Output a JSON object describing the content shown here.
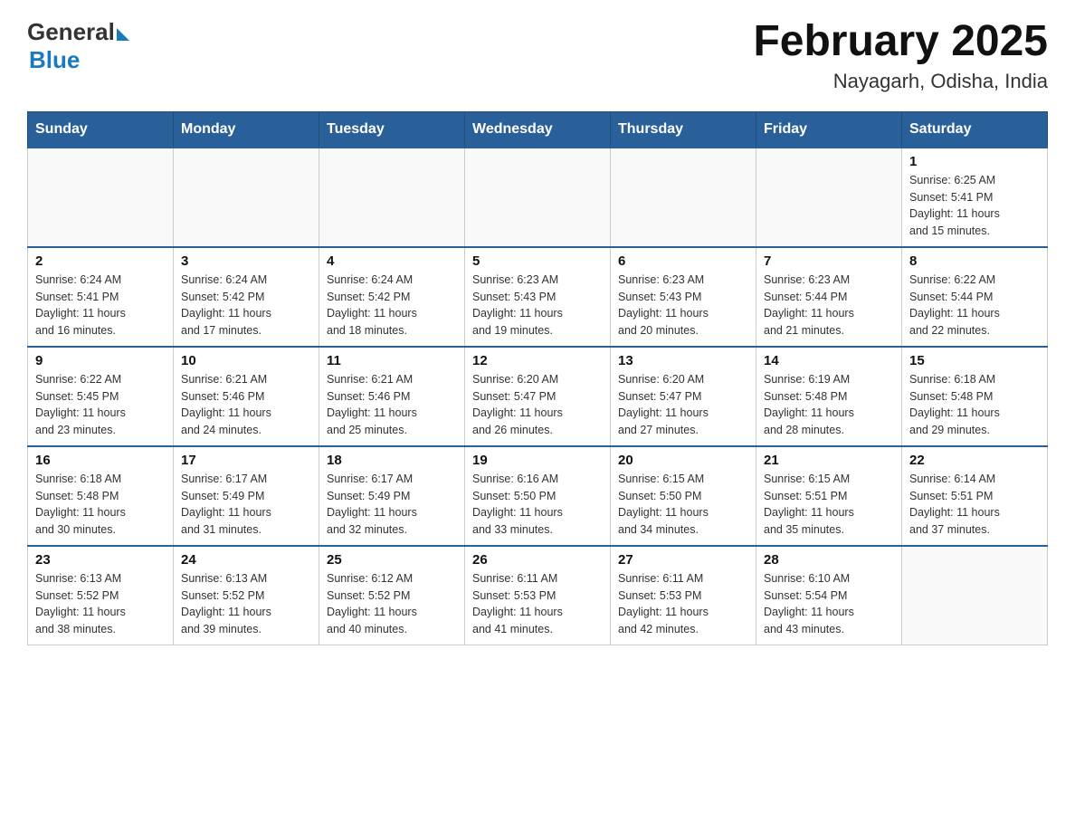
{
  "header": {
    "logo": {
      "general": "General",
      "blue": "Blue",
      "arrow": "▶"
    },
    "title": "February 2025",
    "location": "Nayagarh, Odisha, India"
  },
  "days_of_week": [
    "Sunday",
    "Monday",
    "Tuesday",
    "Wednesday",
    "Thursday",
    "Friday",
    "Saturday"
  ],
  "weeks": [
    [
      {
        "day": "",
        "info": ""
      },
      {
        "day": "",
        "info": ""
      },
      {
        "day": "",
        "info": ""
      },
      {
        "day": "",
        "info": ""
      },
      {
        "day": "",
        "info": ""
      },
      {
        "day": "",
        "info": ""
      },
      {
        "day": "1",
        "info": "Sunrise: 6:25 AM\nSunset: 5:41 PM\nDaylight: 11 hours\nand 15 minutes."
      }
    ],
    [
      {
        "day": "2",
        "info": "Sunrise: 6:24 AM\nSunset: 5:41 PM\nDaylight: 11 hours\nand 16 minutes."
      },
      {
        "day": "3",
        "info": "Sunrise: 6:24 AM\nSunset: 5:42 PM\nDaylight: 11 hours\nand 17 minutes."
      },
      {
        "day": "4",
        "info": "Sunrise: 6:24 AM\nSunset: 5:42 PM\nDaylight: 11 hours\nand 18 minutes."
      },
      {
        "day": "5",
        "info": "Sunrise: 6:23 AM\nSunset: 5:43 PM\nDaylight: 11 hours\nand 19 minutes."
      },
      {
        "day": "6",
        "info": "Sunrise: 6:23 AM\nSunset: 5:43 PM\nDaylight: 11 hours\nand 20 minutes."
      },
      {
        "day": "7",
        "info": "Sunrise: 6:23 AM\nSunset: 5:44 PM\nDaylight: 11 hours\nand 21 minutes."
      },
      {
        "day": "8",
        "info": "Sunrise: 6:22 AM\nSunset: 5:44 PM\nDaylight: 11 hours\nand 22 minutes."
      }
    ],
    [
      {
        "day": "9",
        "info": "Sunrise: 6:22 AM\nSunset: 5:45 PM\nDaylight: 11 hours\nand 23 minutes."
      },
      {
        "day": "10",
        "info": "Sunrise: 6:21 AM\nSunset: 5:46 PM\nDaylight: 11 hours\nand 24 minutes."
      },
      {
        "day": "11",
        "info": "Sunrise: 6:21 AM\nSunset: 5:46 PM\nDaylight: 11 hours\nand 25 minutes."
      },
      {
        "day": "12",
        "info": "Sunrise: 6:20 AM\nSunset: 5:47 PM\nDaylight: 11 hours\nand 26 minutes."
      },
      {
        "day": "13",
        "info": "Sunrise: 6:20 AM\nSunset: 5:47 PM\nDaylight: 11 hours\nand 27 minutes."
      },
      {
        "day": "14",
        "info": "Sunrise: 6:19 AM\nSunset: 5:48 PM\nDaylight: 11 hours\nand 28 minutes."
      },
      {
        "day": "15",
        "info": "Sunrise: 6:18 AM\nSunset: 5:48 PM\nDaylight: 11 hours\nand 29 minutes."
      }
    ],
    [
      {
        "day": "16",
        "info": "Sunrise: 6:18 AM\nSunset: 5:48 PM\nDaylight: 11 hours\nand 30 minutes."
      },
      {
        "day": "17",
        "info": "Sunrise: 6:17 AM\nSunset: 5:49 PM\nDaylight: 11 hours\nand 31 minutes."
      },
      {
        "day": "18",
        "info": "Sunrise: 6:17 AM\nSunset: 5:49 PM\nDaylight: 11 hours\nand 32 minutes."
      },
      {
        "day": "19",
        "info": "Sunrise: 6:16 AM\nSunset: 5:50 PM\nDaylight: 11 hours\nand 33 minutes."
      },
      {
        "day": "20",
        "info": "Sunrise: 6:15 AM\nSunset: 5:50 PM\nDaylight: 11 hours\nand 34 minutes."
      },
      {
        "day": "21",
        "info": "Sunrise: 6:15 AM\nSunset: 5:51 PM\nDaylight: 11 hours\nand 35 minutes."
      },
      {
        "day": "22",
        "info": "Sunrise: 6:14 AM\nSunset: 5:51 PM\nDaylight: 11 hours\nand 37 minutes."
      }
    ],
    [
      {
        "day": "23",
        "info": "Sunrise: 6:13 AM\nSunset: 5:52 PM\nDaylight: 11 hours\nand 38 minutes."
      },
      {
        "day": "24",
        "info": "Sunrise: 6:13 AM\nSunset: 5:52 PM\nDaylight: 11 hours\nand 39 minutes."
      },
      {
        "day": "25",
        "info": "Sunrise: 6:12 AM\nSunset: 5:52 PM\nDaylight: 11 hours\nand 40 minutes."
      },
      {
        "day": "26",
        "info": "Sunrise: 6:11 AM\nSunset: 5:53 PM\nDaylight: 11 hours\nand 41 minutes."
      },
      {
        "day": "27",
        "info": "Sunrise: 6:11 AM\nSunset: 5:53 PM\nDaylight: 11 hours\nand 42 minutes."
      },
      {
        "day": "28",
        "info": "Sunrise: 6:10 AM\nSunset: 5:54 PM\nDaylight: 11 hours\nand 43 minutes."
      },
      {
        "day": "",
        "info": ""
      }
    ]
  ]
}
